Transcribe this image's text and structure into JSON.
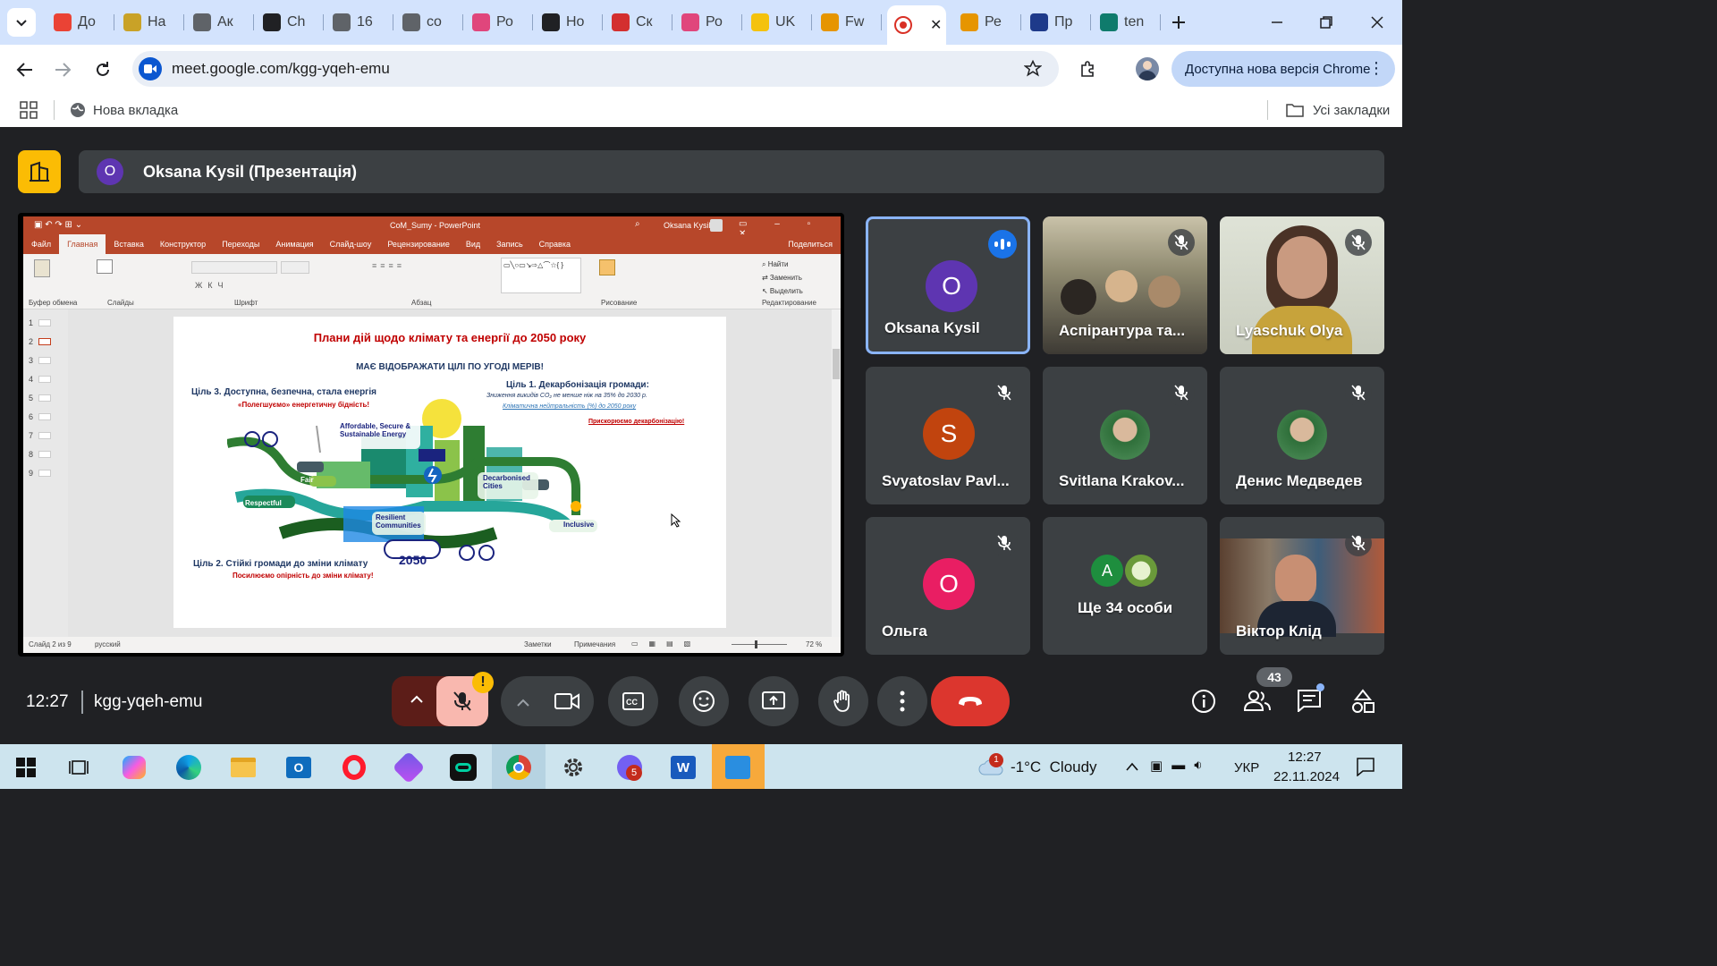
{
  "browser": {
    "tabs": [
      {
        "label": "До",
        "favicon": "gmail-icon",
        "color": "#ea4335"
      },
      {
        "label": "На",
        "favicon": "emblem-icon",
        "color": "#c9a227"
      },
      {
        "label": "Ак",
        "favicon": "globe-icon",
        "color": "#5f6368"
      },
      {
        "label": "Ch",
        "favicon": "chatgpt-icon",
        "color": "#202124"
      },
      {
        "label": "16",
        "favicon": "globe-icon",
        "color": "#5f6368"
      },
      {
        "label": "co",
        "favicon": "globe-icon",
        "color": "#5f6368"
      },
      {
        "label": "Ро",
        "favicon": "prom-icon",
        "color": "#e0467c"
      },
      {
        "label": "Но",
        "favicon": "chatgpt-icon",
        "color": "#202124"
      },
      {
        "label": "Ск",
        "favicon": "heart-icon",
        "color": "#d32f2f"
      },
      {
        "label": "Ро",
        "favicon": "prom-icon",
        "color": "#e0467c"
      },
      {
        "label": "UK",
        "favicon": "ukr-icon",
        "color": "#f4c20d"
      },
      {
        "label": "Fw",
        "favicon": "shop-icon",
        "color": "#e69500"
      },
      {
        "label": "",
        "favicon": "record-icon",
        "color": "#d93025",
        "active": true
      },
      {
        "label": "Ре",
        "favicon": "shop-icon",
        "color": "#e69500"
      },
      {
        "label": "Пр",
        "favicon": "rada-icon",
        "color": "#1e3a8a"
      },
      {
        "label": "ten",
        "favicon": "copilot-icon",
        "color": "#0f7b6c"
      }
    ],
    "url": "meet.google.com/kgg-yqeh-emu",
    "update_label": "Доступна нова версія Chrome",
    "bookmark_new_tab": "Нова вкладка",
    "all_bookmarks": "Усі закладки"
  },
  "meet": {
    "presenter_initial": "O",
    "presenter_label": "Oksana Kysil (Презентація)",
    "meeting_code": "kgg-yqeh-emu",
    "clock": "12:27",
    "participants_count": "43",
    "participants": [
      {
        "name": "Oksana Kysil",
        "initial": "O",
        "color": "#5e35b1",
        "type": "avatar",
        "speaking": true
      },
      {
        "name": "Аспірантура та...",
        "type": "video-room"
      },
      {
        "name": "Lyaschuk Olya",
        "type": "video-woman"
      },
      {
        "name": "Svyatoslav Pavl...",
        "initial": "S",
        "color": "#c1440e",
        "type": "avatar"
      },
      {
        "name": "Svitlana Krakov...",
        "type": "photo"
      },
      {
        "name": "Денис Медведев",
        "type": "photo"
      },
      {
        "name": "Ольга",
        "initial": "O",
        "color": "#e91e63",
        "type": "avatar"
      },
      {
        "name": "Ще 34 особи",
        "initial": "A",
        "color": "#1e8e3e",
        "type": "more"
      },
      {
        "name": "Віктор Клід",
        "type": "video-man"
      }
    ]
  },
  "ppt": {
    "doc_title": "CoM_Sumy - PowerPoint",
    "user": "Oksana Kysil",
    "share": "Поделиться",
    "menu": [
      "Файл",
      "Главная",
      "Вставка",
      "Конструктор",
      "Переходы",
      "Анимация",
      "Слайд-шоу",
      "Рецензирование",
      "Вид",
      "Запись",
      "Справка"
    ],
    "groups": [
      "Буфер обмена",
      "Слайды",
      "Шрифт",
      "Абзац",
      "Рисование",
      "Редактирование"
    ],
    "status_slide": "Слайд 2 из 9",
    "status_lang": "русский",
    "status_notes": "Заметки",
    "status_comments": "Примечания",
    "zoom": "72 %",
    "thumbs": [
      "1",
      "2",
      "3",
      "4",
      "5",
      "6",
      "7",
      "8",
      "9"
    ],
    "slide": {
      "title": "Плани дій щодо клімату та енергії до 2050 року",
      "subtitle": "МАЄ ВІДОБРАЖАТИ  ЦІЛІ ПО УГОДІ МЕРІВ!",
      "goal3": "Ціль 3. Доступна, безпечна, стала енергія",
      "goal3_sub": "«Полегшуємо» енергетичну бідність!",
      "goal1": "Ціль 1. Декарбонізація громади:",
      "goal1_sub1": "Зниження викидів CO₂ не менше ніж на 35% до 2030 р.",
      "goal1_sub2": "Кліматична нейтральність (%) до 2050 року",
      "goal1_sub3": "Прискорюємо декарбонізацію!",
      "goal2": "Ціль 2. Стійкі громади до зміни клімату",
      "goal2_sub": "Посилюємо опірність до зміни клімату!",
      "label_energy": "Affordable, Secure & Sustainable Energy",
      "label_fair": "Fair",
      "label_respectful": "Respectful",
      "label_resilient": "Resilient Communities",
      "label_cities": "Decarbonised Cities",
      "label_inclusive": "Inclusive",
      "label_year": "2050"
    }
  },
  "taskbar": {
    "weather": "-1°C  Cloudy",
    "lang": "УКР",
    "time": "12:27",
    "date": "22.11.2024",
    "badge_weather": "1",
    "badge_viber": "5"
  }
}
